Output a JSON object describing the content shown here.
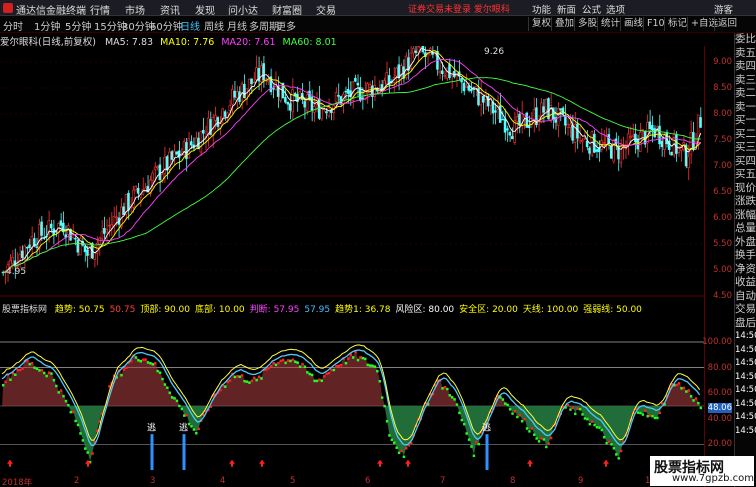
{
  "topbar": {
    "app_title": "通达信金融终端",
    "menus": [
      "行情",
      "市场",
      "资讯",
      "发现",
      "问小达",
      "财富圈",
      "交易"
    ],
    "notice": "证券交易未登录  爱尔眼科",
    "right_menus": [
      "功能",
      "新面",
      "公式",
      "选项",
      "游客"
    ]
  },
  "periods": [
    "分时",
    "1分钟",
    "5分钟",
    "15分钟",
    "30分钟",
    "60分钟",
    "日线",
    "周线",
    "月线",
    "多周期",
    "更多"
  ],
  "active_period": "日线",
  "tools": [
    "复权",
    "叠加",
    "多股",
    "统计",
    "画线",
    "F10",
    "标记",
    "+自选",
    "返回"
  ],
  "main_header": {
    "name": "爱尔眼科(日线,前复权)",
    "ma5": "MA5: 7.83",
    "ma10": "MA10: 7.76",
    "ma20": "MA20: 7.61",
    "ma60": "MA60: 8.01"
  },
  "price_labels": {
    "high": "9.26",
    "low": "4.95"
  },
  "yaxis_main": [
    "9.00",
    "8.50",
    "8.00",
    "7.50",
    "7.00",
    "6.50",
    "6.00",
    "5.50",
    "5.00",
    "4.50"
  ],
  "yaxis_sub": [
    "100.00",
    "80.00",
    "60.00",
    "48.06",
    "40.00",
    "20.00",
    "0.00"
  ],
  "current_value": "48.06",
  "sub_header": {
    "name": "股票指标网",
    "items": [
      {
        "text": "趋势: 50.75",
        "color": "#ffff00"
      },
      {
        "text": "50.75",
        "color": "#ff4040"
      },
      {
        "text": "顶部: 90.00",
        "color": "#ffff00"
      },
      {
        "text": "底部: 10.00",
        "color": "#ffff00"
      },
      {
        "text": "判断: 57.95",
        "color": "#ff40ff"
      },
      {
        "text": "57.95",
        "color": "#40c0ff"
      },
      {
        "text": "趋势1: 36.78",
        "color": "#ffff00"
      },
      {
        "text": "风险区: 80.00",
        "color": "#ffffff"
      },
      {
        "text": "安全区: 20.00",
        "color": "#ffff00"
      },
      {
        "text": "天线: 100.00",
        "color": "#ffff00"
      },
      {
        "text": "强弱线: 50.00",
        "color": "#ffff00"
      }
    ]
  },
  "escape_label": "逃",
  "xaxis": [
    "2018年",
    "2",
    "3",
    "4",
    "5",
    "6",
    "7",
    "8",
    "9",
    "10",
    "11"
  ],
  "side_panel": [
    "委比",
    "卖五",
    "卖四",
    "卖三",
    "卖二",
    "卖一",
    "买一",
    "买二",
    "买三",
    "买四",
    "买五",
    "现价",
    "涨跌",
    "涨幅",
    "总量",
    "外盘",
    "换手",
    "净资",
    "收益",
    "自动",
    "交易",
    "盘后",
    "14:50",
    "14:50",
    "14:50",
    "14:50",
    "14:50",
    "14:50",
    "14:50",
    "14:50"
  ],
  "watermark": {
    "line1": "股票指标网",
    "line2": "www.7gpzb.com"
  },
  "chart_data": {
    "type": "candlestick",
    "ohlc_sample": [
      [
        5.1,
        5.3,
        5.0,
        5.25
      ],
      [
        5.25,
        5.6,
        5.2,
        5.5
      ],
      [
        5.5,
        5.9,
        5.4,
        5.8
      ],
      [
        5.8,
        6.4,
        5.7,
        6.3
      ],
      [
        6.3,
        6.9,
        6.2,
        6.7
      ],
      [
        6.7,
        7.6,
        6.6,
        7.4
      ],
      [
        7.4,
        8.3,
        7.3,
        8.1
      ],
      [
        8.1,
        8.9,
        8.0,
        8.6
      ],
      [
        8.6,
        8.3,
        7.6,
        7.8
      ],
      [
        7.8,
        8.4,
        7.7,
        8.2
      ],
      [
        8.2,
        9.26,
        8.1,
        8.9
      ],
      [
        8.9,
        9.0,
        8.3,
        8.5
      ],
      [
        8.5,
        8.6,
        7.5,
        7.7
      ],
      [
        7.7,
        8.0,
        7.0,
        7.4
      ],
      [
        7.4,
        8.2,
        7.3,
        8.1
      ]
    ]
  }
}
